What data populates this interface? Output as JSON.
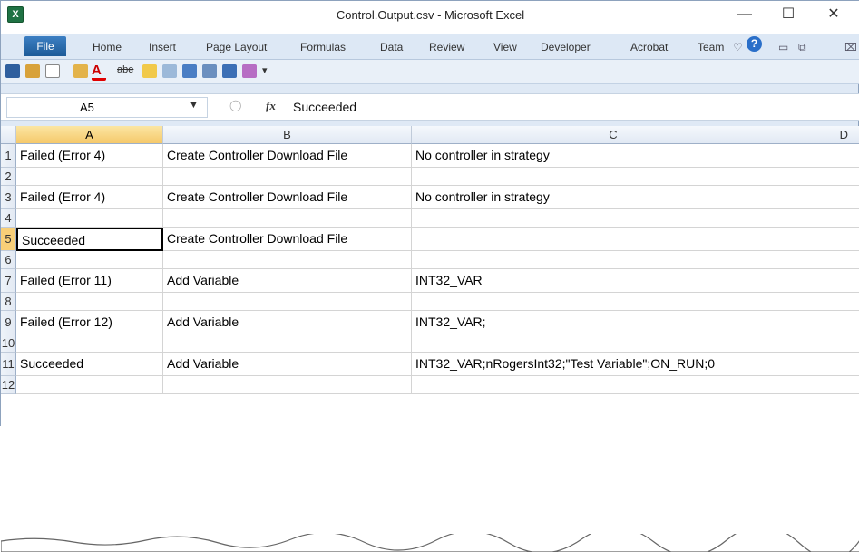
{
  "window": {
    "title": "Control.Output.csv - Microsoft Excel",
    "app_icon_letter": "X"
  },
  "ribbon": {
    "file_label": "File",
    "tabs": [
      "Home",
      "Insert",
      "Page Layout",
      "Formulas",
      "Data",
      "Review",
      "View",
      "Developer",
      "Acrobat",
      "Team"
    ]
  },
  "formula_bar": {
    "name_box": "A5",
    "fx_label": "fx",
    "value": "Succeeded"
  },
  "sheet": {
    "columns": [
      "A",
      "B",
      "C",
      "D"
    ],
    "selected_column": "A",
    "selected_row": 5,
    "rows": [
      {
        "num": "1",
        "a": "Failed (Error 4)",
        "b": "Create Controller Download File",
        "c": "No controller in strategy"
      },
      {
        "num": "2",
        "a": "",
        "b": "",
        "c": ""
      },
      {
        "num": "3",
        "a": "Failed (Error 4)",
        "b": "Create Controller Download File",
        "c": "No controller in strategy"
      },
      {
        "num": "4",
        "a": "",
        "b": "",
        "c": ""
      },
      {
        "num": "5",
        "a": "Succeeded",
        "b": "Create Controller Download File",
        "c": ""
      },
      {
        "num": "6",
        "a": "",
        "b": "",
        "c": ""
      },
      {
        "num": "7",
        "a": "Failed (Error 11)",
        "b": "Add Variable",
        "c": "INT32_VAR"
      },
      {
        "num": "8",
        "a": "",
        "b": "",
        "c": ""
      },
      {
        "num": "9",
        "a": "Failed (Error 12)",
        "b": "Add Variable",
        "c": "INT32_VAR;"
      },
      {
        "num": "10",
        "a": "",
        "b": "",
        "c": ""
      },
      {
        "num": "11",
        "a": "Succeeded",
        "b": "Add Variable",
        "c": "INT32_VAR;nRogersInt32;\"Test Variable\";ON_RUN;0"
      },
      {
        "num": "12",
        "a": "",
        "b": "",
        "c": ""
      }
    ]
  },
  "colors": {
    "accent": "#1f7244",
    "selection": "#f8cf78",
    "file_tab": "#2d6db0"
  }
}
